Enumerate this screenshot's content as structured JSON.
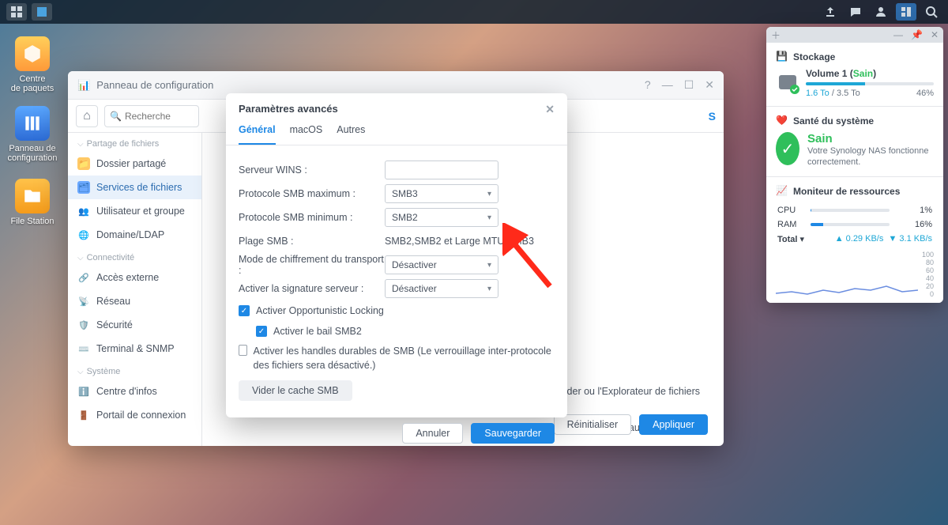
{
  "topbar_icons": [
    "grid",
    "app"
  ],
  "desk": {
    "pkg": "Centre\nde paquets",
    "cfg": "Panneau de\nconfiguration",
    "fs": "File Station"
  },
  "cp": {
    "title": "Panneau de configuration",
    "search_placeholder": "Recherche",
    "sections": {
      "share": "Partage de fichiers",
      "connect": "Connectivité",
      "system": "Système"
    },
    "nav": {
      "shared": "Dossier partagé",
      "fileservices": "Services de fichiers",
      "usergroup": "Utilisateur et groupe",
      "domain": "Domaine/LDAP",
      "extaccess": "Accès externe",
      "network": "Réseau",
      "security": "Sécurité",
      "terminal": "Terminal & SNMP",
      "infocenter": "Centre d'infos",
      "portal": "Portail de connexion"
    },
    "hint1": "Finder ou l'Explorateur de fichiers",
    "hint2": "ateur sur votre réseau local :",
    "reset": "Réinitialiser",
    "apply": "Appliquer"
  },
  "modal": {
    "title": "Paramètres avancés",
    "tabs": {
      "general": "Général",
      "macos": "macOS",
      "other": "Autres"
    },
    "labels": {
      "wins": "Serveur WINS :",
      "smbmax": "Protocole SMB maximum :",
      "smbmin": "Protocole SMB minimum :",
      "range": "Plage SMB :",
      "crypt": "Mode de chiffrement du transport :",
      "sign": "Activer la signature serveur :"
    },
    "values": {
      "wins": "",
      "smbmax": "SMB3",
      "smbmin": "SMB2",
      "range": "SMB2,SMB2 et Large MTU,SMB3",
      "crypt": "Désactiver",
      "sign": "Désactiver"
    },
    "checks": {
      "oplock": "Activer Opportunistic Locking",
      "lease": "Activer le bail SMB2",
      "durable": "Activer les handles durables de SMB (Le verrouillage inter-protocole des fichiers sera désactivé.)"
    },
    "clearcache": "Vider le cache SMB",
    "cancel": "Annuler",
    "save": "Sauvegarder"
  },
  "widgets": {
    "storage_title": "Stockage",
    "volume": "Volume 1 (",
    "volume_state": "Sain",
    "volume_close": ")",
    "used": "1.6 To",
    "sep": " / ",
    "total": "3.5 To",
    "pct": "46%",
    "health_title": "Santé du système",
    "health_state": "Sain",
    "health_msg": "Votre Synology NAS fonctionne correctement.",
    "resmon_title": "Moniteur de ressources",
    "cpu": "CPU",
    "cpu_v": "1%",
    "ram": "RAM",
    "ram_v": "16%",
    "total_lbl": "Total",
    "up": "0.29 KB/s",
    "dn": "3.1 KB/s",
    "ylabels": [
      "100",
      "80",
      "60",
      "40",
      "20",
      "0"
    ]
  }
}
